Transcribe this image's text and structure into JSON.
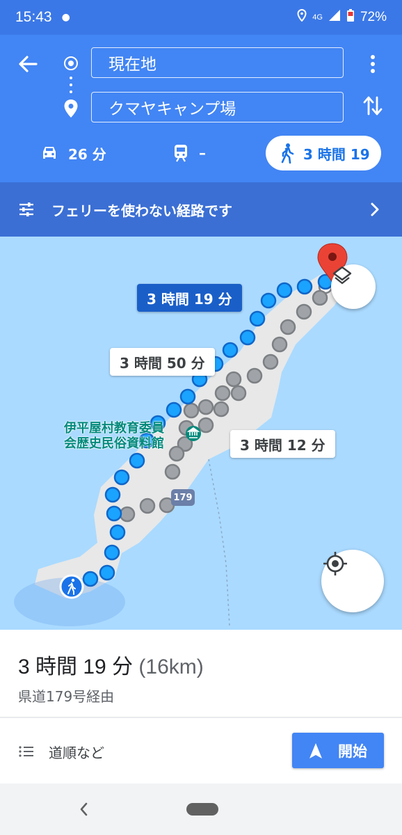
{
  "status_bar": {
    "time": "15:43",
    "network": "4G",
    "battery": "72%"
  },
  "search": {
    "origin": "現在地",
    "destination": "クマヤキャンプ場"
  },
  "modes": {
    "car": "26 分",
    "transit": "–",
    "walk": "3 時間 19"
  },
  "notice": {
    "text": "フェリーを使わない経路です"
  },
  "map": {
    "route_labels": {
      "selected": "3 時間 19 分",
      "alt1": "3 時間 50 分",
      "alt2": "3 時間 12 分"
    },
    "poi": {
      "line1": "伊平屋村教育委員",
      "line2": "会歴史民俗資料館"
    },
    "route_shield": "179",
    "colors": {
      "water": "#aadaff",
      "land": "#e8e8e8",
      "route_selected": "#1aa3ff",
      "route_alt": "#a0a4a8",
      "pin": "#ea4335"
    }
  },
  "summary": {
    "duration": "3 時間 19 分",
    "distance": "(16km)",
    "via": "県道179号経由"
  },
  "actions": {
    "steps": "道順など",
    "start": "開始"
  }
}
